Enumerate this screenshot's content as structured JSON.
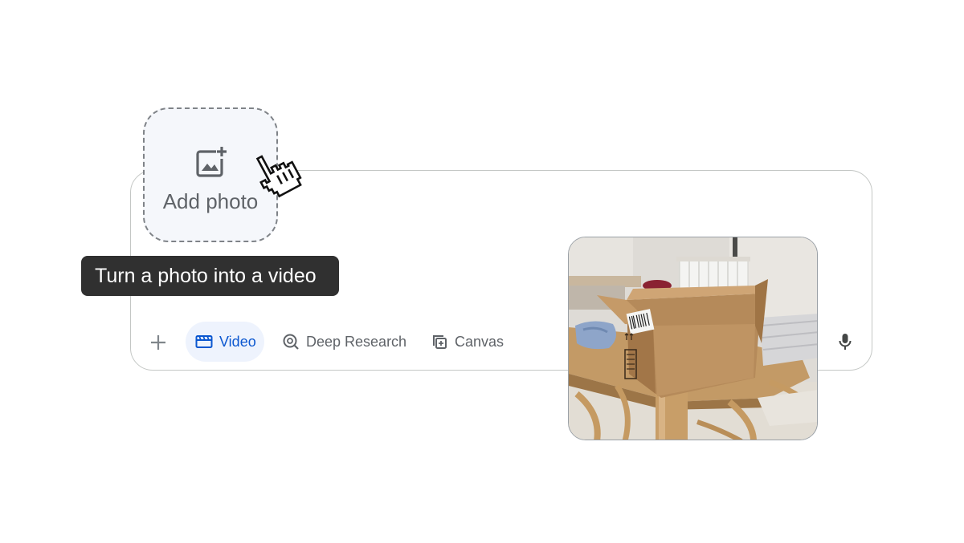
{
  "upload": {
    "label": "Add photo",
    "icon": "add-photo-icon"
  },
  "tooltip": {
    "text": "Turn a photo into a video"
  },
  "toolbar": {
    "add_icon": "plus-icon",
    "chips": [
      {
        "label": "Video",
        "icon": "video-clapper-icon",
        "selected": true
      },
      {
        "label": "Deep Research",
        "icon": "deep-research-icon",
        "selected": false
      },
      {
        "label": "Canvas",
        "icon": "canvas-icon",
        "selected": false
      }
    ],
    "mic_icon": "microphone-icon"
  },
  "colors": {
    "accent": "#0b57d0",
    "selected_chip_bg": "#eef3fd",
    "tooltip_bg": "#303030",
    "dropzone_bg": "#f5f7fb",
    "border": "#c4c7c5"
  }
}
